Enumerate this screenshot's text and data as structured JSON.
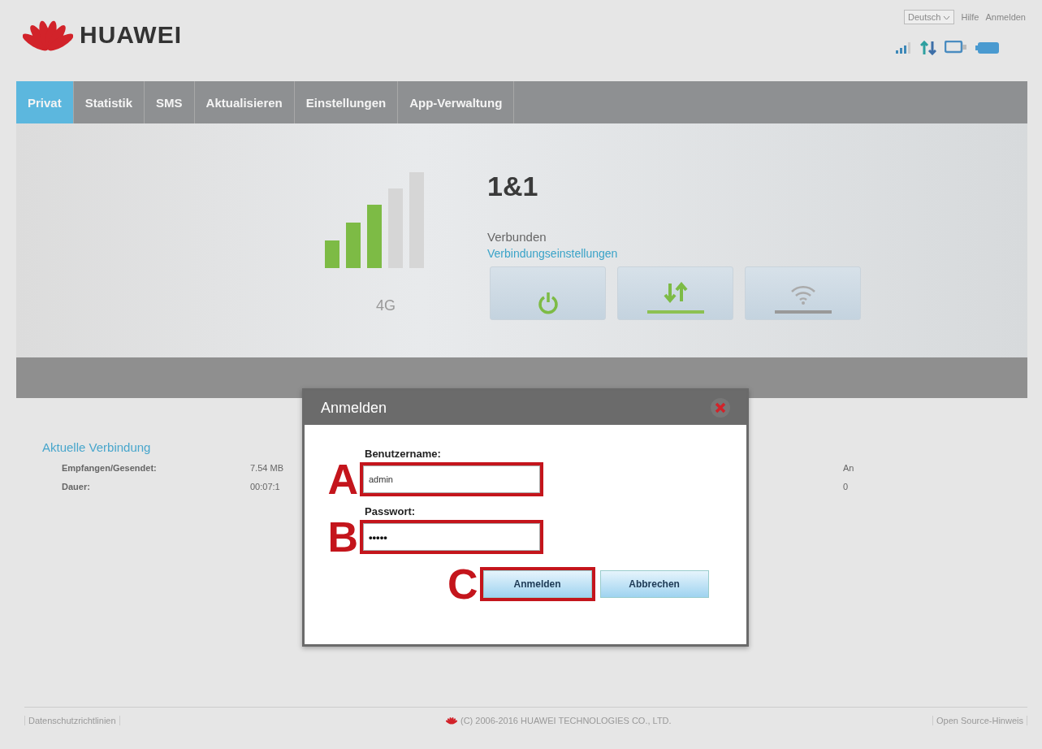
{
  "header": {
    "brand": "HUAWEI",
    "language": "Deutsch",
    "links": [
      "Hilfe",
      "Anmelden"
    ]
  },
  "nav": [
    {
      "label": "Privat",
      "selected": true
    },
    {
      "label": "Statistik",
      "selected": false
    },
    {
      "label": "SMS",
      "selected": false
    },
    {
      "label": "Aktualisieren",
      "selected": false
    },
    {
      "label": "Einstellungen",
      "selected": false
    },
    {
      "label": "App-Verwaltung",
      "selected": false
    }
  ],
  "network": {
    "type": "4G",
    "provider": "1&1",
    "status": "Verbunden",
    "settings_link": "Verbindungseinstellungen"
  },
  "toggles": [
    {
      "kind": "power",
      "on": true
    },
    {
      "kind": "data",
      "on": true
    },
    {
      "kind": "wifi",
      "on": false
    }
  ],
  "connection": {
    "title": "Aktuelle Verbindung",
    "rows": [
      {
        "label": "Empfangen/Gesendet:",
        "value": "7.54 MB",
        "extra": "An"
      },
      {
        "label": "Dauer:",
        "value": "00:07:1",
        "extra": "0"
      }
    ]
  },
  "dialog": {
    "title": "Anmelden",
    "fields": [
      {
        "kind": "text",
        "label": "Benutzername:",
        "value": "admin",
        "callout": "A"
      },
      {
        "kind": "password",
        "label": "Passwort:",
        "value": "•••••",
        "callout": "B"
      }
    ],
    "buttons": [
      {
        "label": "Anmelden",
        "callout": "C"
      },
      {
        "label": "Abbrechen"
      }
    ]
  },
  "footer": {
    "left": "Datenschutzrichtlinien",
    "copyright": "(C) 2006-2016 HUAWEI TECHNOLOGIES CO., LTD.",
    "right": "Open Source-Hinweis"
  }
}
